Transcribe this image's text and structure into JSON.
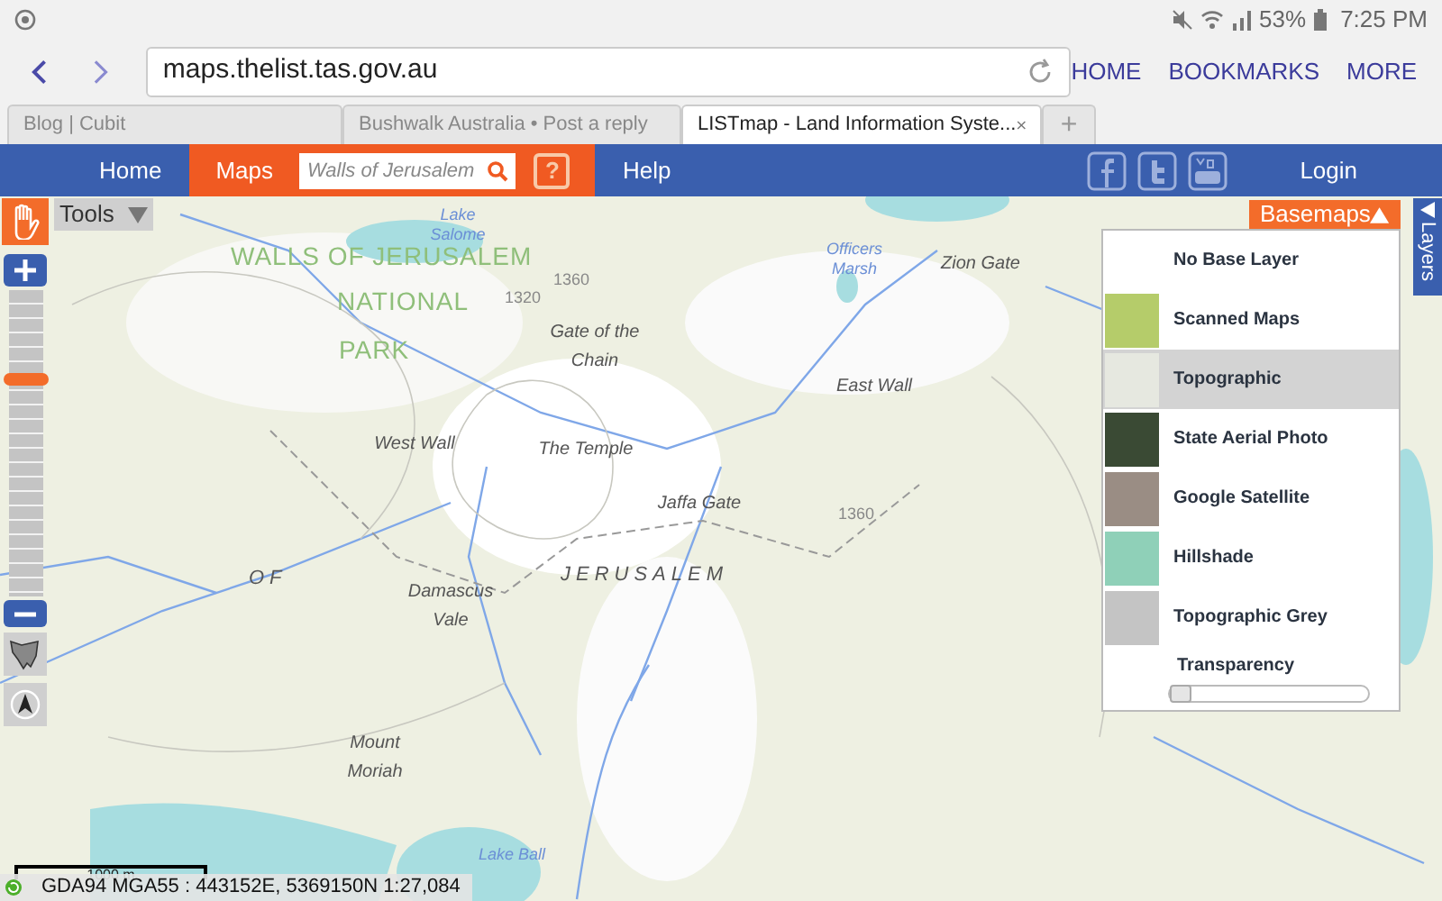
{
  "status_bar": {
    "battery": "53%",
    "time": "7:25 PM"
  },
  "browser": {
    "url": "maps.thelist.tas.gov.au",
    "nav_links": [
      "HOME",
      "BOOKMARKS",
      "MORE"
    ],
    "tabs": [
      {
        "label": "Blog | Cubit",
        "selected": false
      },
      {
        "label": "Bushwalk Australia • Post a reply",
        "selected": false
      },
      {
        "label": "LISTmap - Land Information Syste...",
        "selected": true
      }
    ],
    "new_tab": "+"
  },
  "site_nav": {
    "items": [
      {
        "label": "Home",
        "selected": false
      },
      {
        "label": "Maps",
        "selected": true
      },
      {
        "label": "Help",
        "selected": false
      }
    ],
    "search": {
      "placeholder": "Walls of Jerusalem"
    },
    "help_icon": "?",
    "login": "Login"
  },
  "map": {
    "labels": [
      {
        "text": "WALLS OF JERUSALEM",
        "kind": "park"
      },
      {
        "text": "NATIONAL",
        "kind": "park"
      },
      {
        "text": "PARK",
        "kind": "park"
      },
      {
        "text": "Lake Salome",
        "kind": "water"
      },
      {
        "text": "Officers Marsh",
        "kind": "water"
      },
      {
        "text": "Zion Gate",
        "kind": "place"
      },
      {
        "text": "1320",
        "kind": "contour"
      },
      {
        "text": "1360",
        "kind": "contour"
      },
      {
        "text": "Gate of the Chain",
        "kind": "place"
      },
      {
        "text": "West Wall",
        "kind": "place"
      },
      {
        "text": "The Temple",
        "kind": "place"
      },
      {
        "text": "Jaffa Gate",
        "kind": "place"
      },
      {
        "text": "East Wall",
        "kind": "place"
      },
      {
        "text": "1360",
        "kind": "contour"
      },
      {
        "text": "OF",
        "kind": "region"
      },
      {
        "text": "JERUSALEM",
        "kind": "region"
      },
      {
        "text": "Damascus Vale",
        "kind": "place"
      },
      {
        "text": "Mount Moriah",
        "kind": "place"
      },
      {
        "text": "Lake Ball",
        "kind": "water"
      }
    ],
    "scale": "1000 m",
    "coordinates": "GDA94 MGA55 : 443152E, 5369150N 1:27,084"
  },
  "tools": {
    "label": "Tools"
  },
  "zoom": {
    "level": 0.72
  },
  "basemaps": {
    "title": "Basemaps",
    "items": [
      {
        "label": "No Base Layer",
        "selected": false
      },
      {
        "label": "Scanned Maps",
        "selected": false,
        "color": "#b5cc6a"
      },
      {
        "label": "Topographic",
        "selected": true,
        "color": "#e6e8e0"
      },
      {
        "label": "State Aerial Photo",
        "selected": false,
        "color": "#3a4a34"
      },
      {
        "label": "Google Satellite",
        "selected": false,
        "color": "#9a8d84"
      },
      {
        "label": "Hillshade",
        "selected": false,
        "color": "#8fd0b8"
      },
      {
        "label": "Topographic Grey",
        "selected": false,
        "color": "#c4c4c4"
      }
    ],
    "transparency": {
      "label": "Transparency",
      "level": 0
    }
  },
  "layers_tab": "Layers"
}
